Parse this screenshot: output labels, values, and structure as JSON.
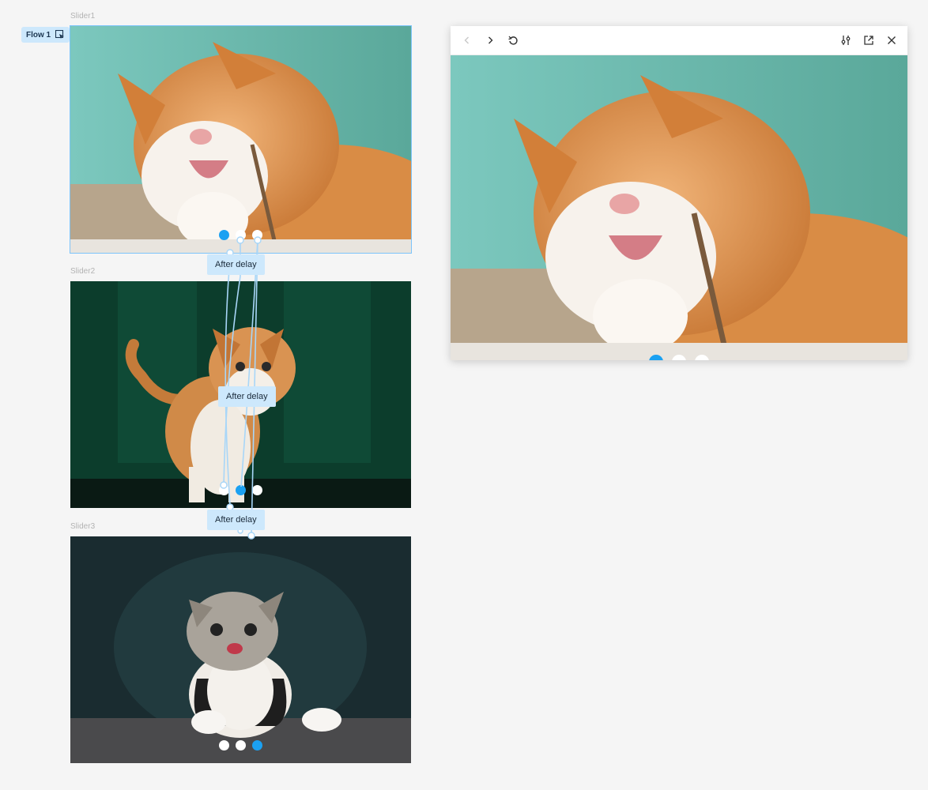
{
  "canvas": {
    "frames": [
      {
        "label": "Slider1",
        "active_dot": 0
      },
      {
        "label": "Slider2",
        "active_dot": 1
      },
      {
        "label": "Slider3",
        "active_dot": 2
      }
    ],
    "flow": {
      "label": "Flow 1",
      "icon": "play-icon"
    },
    "interactions": [
      {
        "label": "After delay"
      },
      {
        "label": "After delay"
      },
      {
        "label": "After delay"
      }
    ]
  },
  "preview": {
    "toolbar": {
      "back_icon": "chevron-left-icon",
      "forward_icon": "chevron-right-icon",
      "restart_icon": "restart-icon",
      "settings_icon": "sliders-icon",
      "open_icon": "open-external-icon",
      "close_icon": "close-icon"
    },
    "active_dot": 0
  },
  "colors": {
    "accent": "#1ba1f2",
    "selection": "#7cc4fa",
    "badge_bg": "#cde8fc",
    "canvas_bg": "#f5f5f5"
  }
}
